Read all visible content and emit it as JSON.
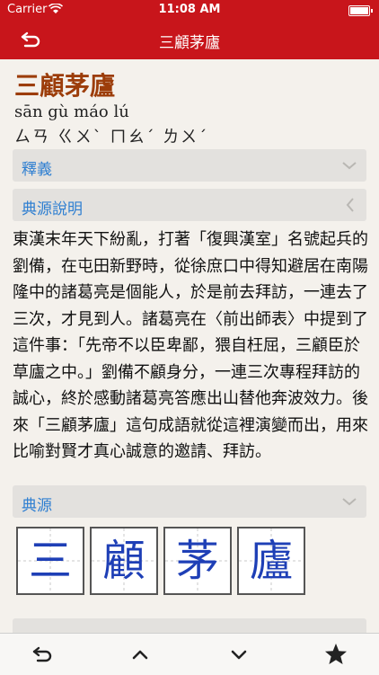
{
  "status": {
    "carrier": "Carrier",
    "time": "11:08 AM"
  },
  "nav": {
    "title": "三顧茅廬"
  },
  "entry": {
    "term": "三顧茅廬",
    "pinyin": "sān gù máo lú",
    "zhuyin": "ㄙㄢ  ㄍㄨˋ  ㄇㄠˊ  ㄌㄨˊ"
  },
  "sections": {
    "definition": "釋義",
    "source_explanation": "典源說明",
    "source": "典源"
  },
  "body": "東漢末年天下紛亂，打著「復興漢室」名號起兵的劉備，在屯田新野時，從徐庶口中得知避居在南陽隆中的諸葛亮是個能人，於是前去拜訪，一連去了三次，才見到人。諸葛亮在〈前出師表〉中提到了這件事：「先帝不以臣卑鄙，猥自枉屈，三顧臣於草廬之中。」劉備不顧身分，一連三次專程拜訪的誠心，終於感動諸葛亮答應出山替他奔波效力。後來「三顧茅廬」這句成語就從這裡演變而出，用來比喻對賢才真心誠意的邀請、拜訪。",
  "characters": [
    "三",
    "顧",
    "茅",
    "廬"
  ],
  "colors": {
    "accent": "#c8151b",
    "link": "#2f7fd1",
    "term": "#9c3d0a",
    "glyph": "#1e3fb6"
  },
  "toolbar": {
    "icons": [
      "back-arrow-icon",
      "chevron-up-icon",
      "chevron-down-icon",
      "star-icon"
    ]
  }
}
